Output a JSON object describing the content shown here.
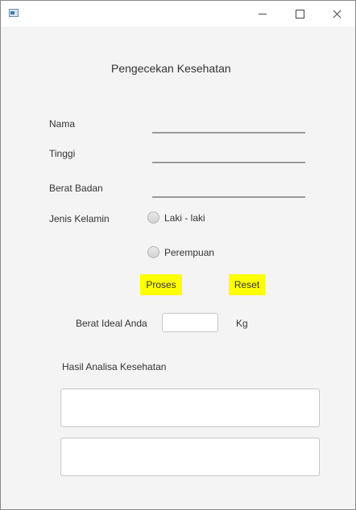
{
  "window": {
    "title": "",
    "buttons": [
      "minimize",
      "maximize",
      "close"
    ]
  },
  "form": {
    "heading": "Pengecekan Kesehatan",
    "labels": {
      "nama": "Nama",
      "tinggi": "Tinggi",
      "berat_badan": "Berat Badan",
      "jenis_kelamin": "Jenis Kelamin"
    },
    "values": {
      "nama": "",
      "tinggi": "",
      "berat_badan": ""
    },
    "gender_options": {
      "male": "Laki - laki",
      "female": "Perempuan"
    },
    "buttons": {
      "proses": "Proses",
      "reset": "Reset"
    },
    "button_color": "#ffff00",
    "ideal_weight": {
      "label": "Berat Ideal Anda",
      "value": "",
      "unit": "Kg"
    },
    "analysis": {
      "label": "Hasil Analisa Kesehatan",
      "output_1": "",
      "output_2": ""
    }
  }
}
